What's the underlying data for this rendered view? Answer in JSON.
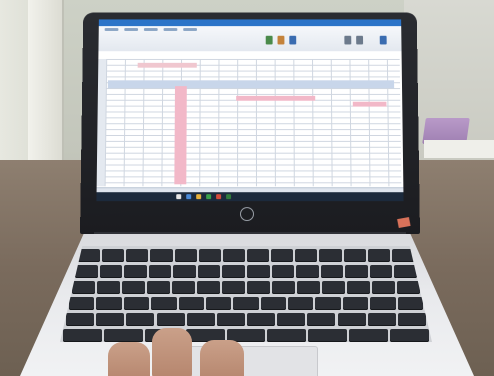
{
  "photo": {
    "subject": "",
    "screen": {
      "app": "",
      "window_title": ""
    },
    "laptop_brand": ""
  },
  "colors": {
    "lid": "#1b1c20",
    "screen_bg": "#eef2f8",
    "titlebar": "#2b74c8",
    "header_fill": "#c8d6ea",
    "highlight_fill": "#f2b8c8",
    "taskbar": "#1c2a3c",
    "keyboard_keys": "#2b2e34",
    "base": "#e8e9ec",
    "table": "#7a6b5d"
  }
}
